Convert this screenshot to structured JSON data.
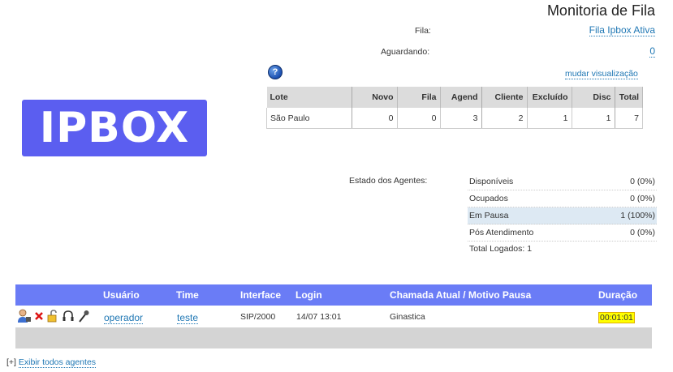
{
  "header": {
    "title": "Monitoria de Fila"
  },
  "queue_info": {
    "fila_label": "Fila:",
    "fila_value": "Fila Ipbox Ativa",
    "aguardando_label": "Aguardando:",
    "aguardando_value": "0",
    "help_symbol": "?",
    "change_view_link": "mudar visualização"
  },
  "logo": {
    "text": "IPBOX"
  },
  "queue_table": {
    "headers": [
      "Lote",
      "Novo",
      "Fila",
      "Agend",
      "Cliente",
      "Excluído",
      "Disc",
      "Total"
    ],
    "rows": [
      [
        "São Paulo",
        "0",
        "0",
        "3",
        "2",
        "1",
        "1",
        "7"
      ]
    ]
  },
  "agent_state": {
    "label": "Estado dos Agentes:",
    "items": [
      {
        "name": "Disponíveis",
        "value": "0 (0%)"
      },
      {
        "name": "Ocupados",
        "value": "0 (0%)"
      },
      {
        "name": "Em Pausa",
        "value": "1 (100%)"
      },
      {
        "name": "Pós Atendimento",
        "value": "0 (0%)"
      }
    ],
    "total": "Total Logados: 1",
    "highlight_color": "#dde9f3"
  },
  "agents_table": {
    "headers": {
      "usuario": "Usuário",
      "time": "Time",
      "interface": "Interface",
      "login": "Login",
      "chamada": "Chamada Atual / Motivo Pausa",
      "duracao": "Duração"
    },
    "rows": [
      {
        "icons": [
          "user-agent-icon",
          "remove-x-icon",
          "unlock-icon",
          "headset-icon",
          "microphone-icon"
        ],
        "usuario": "operador",
        "time": "teste",
        "interface": "SIP/2000",
        "login": "14/07 13:01",
        "chamada": "Ginastica",
        "duracao": "00:01:01"
      }
    ],
    "header_color": "#6a7cf6",
    "duration_highlight": "#ffff00"
  },
  "footer": {
    "prefix": "[+]",
    "link": "Exibir todos agentes"
  }
}
